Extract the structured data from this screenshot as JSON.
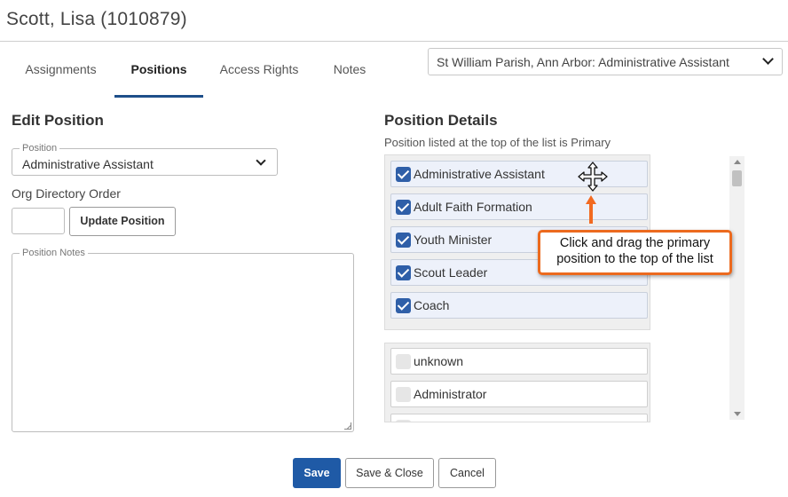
{
  "header": {
    "title": "Scott, Lisa (1010879)"
  },
  "tabs": [
    {
      "label": "Assignments"
    },
    {
      "label": "Positions"
    },
    {
      "label": "Access Rights"
    },
    {
      "label": "Notes"
    }
  ],
  "context_select": {
    "value": "St William Parish, Ann Arbor: Administrative Assistant"
  },
  "edit_position": {
    "title": "Edit Position",
    "position_legend": "Position",
    "position_value": "Administrative Assistant",
    "org_directory_label": "Org Directory Order",
    "org_directory_value": "",
    "update_button": "Update Position",
    "notes_legend": "Position Notes",
    "notes_value": ""
  },
  "position_details": {
    "title": "Position Details",
    "subtitle": "Position listed at the top of the list is Primary",
    "selected": [
      {
        "label": "Administrative Assistant",
        "checked": true
      },
      {
        "label": "Adult Faith Formation",
        "checked": true
      },
      {
        "label": "Youth Minister",
        "checked": true
      },
      {
        "label": "Scout Leader",
        "checked": true
      },
      {
        "label": "Coach",
        "checked": true
      }
    ],
    "available": [
      {
        "label": "unknown",
        "checked": false
      },
      {
        "label": "Administrator",
        "checked": false
      },
      {
        "label": "",
        "checked": false
      }
    ]
  },
  "callout": {
    "line1": "Click and drag the primary",
    "line2": "position to the top of the list"
  },
  "footer": {
    "save": "Save",
    "save_close": "Save & Close",
    "cancel": "Cancel"
  },
  "colors": {
    "primary": "#1f5aa6",
    "callout_border": "#ec6a1e",
    "arrow": "#f26a21",
    "tab_underline": "#1e4f8a"
  }
}
